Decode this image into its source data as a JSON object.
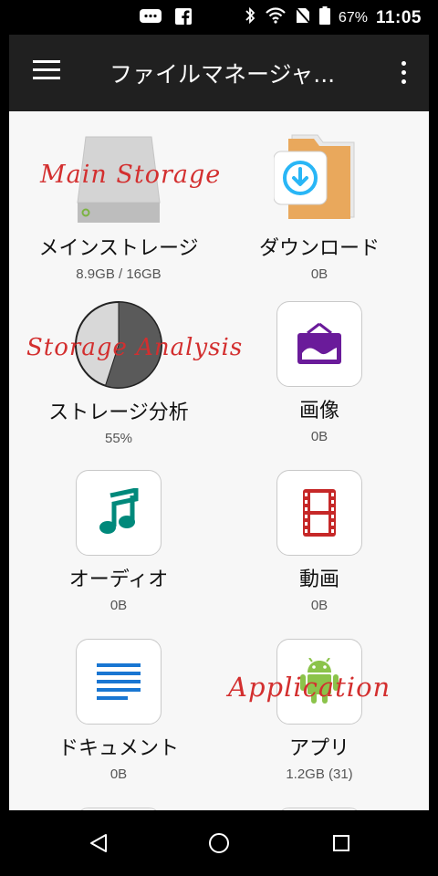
{
  "status_bar": {
    "battery_percent": "67%",
    "time": "11:05",
    "icons": [
      "message-icon",
      "facebook-icon",
      "bluetooth-icon",
      "wifi-icon",
      "no-sim-icon",
      "battery-icon"
    ]
  },
  "app_bar": {
    "title": "ファイルマネージャ...",
    "menu_icon": "hamburger-menu-icon",
    "overflow_icon": "more-vert-icon"
  },
  "items": [
    {
      "label": "メインストレージ",
      "sub": "8.9GB / 16GB",
      "icon": "hard-drive-icon"
    },
    {
      "label": "ダウンロード",
      "sub": "0B",
      "icon": "download-folder-icon"
    },
    {
      "label": "ストレージ分析",
      "sub": "55%",
      "icon": "pie-chart-icon",
      "used_fraction": 0.55
    },
    {
      "label": "画像",
      "sub": "0B",
      "icon": "image-icon",
      "color": "#6a1b9a"
    },
    {
      "label": "オーディオ",
      "sub": "0B",
      "icon": "music-note-icon",
      "color": "#00897b"
    },
    {
      "label": "動画",
      "sub": "0B",
      "icon": "film-icon",
      "color": "#c62828"
    },
    {
      "label": "ドキュメント",
      "sub": "0B",
      "icon": "document-icon",
      "color": "#1976d2"
    },
    {
      "label": "アプリ",
      "sub": "1.2GB (31)",
      "icon": "android-icon",
      "color": "#8bc34a"
    }
  ],
  "annotations": {
    "main_storage": "Main Storage",
    "storage_analysis": "Storage Analysis",
    "application": "Application"
  },
  "nav_bar": {
    "icons": [
      "back-icon",
      "home-icon",
      "recents-icon"
    ]
  }
}
